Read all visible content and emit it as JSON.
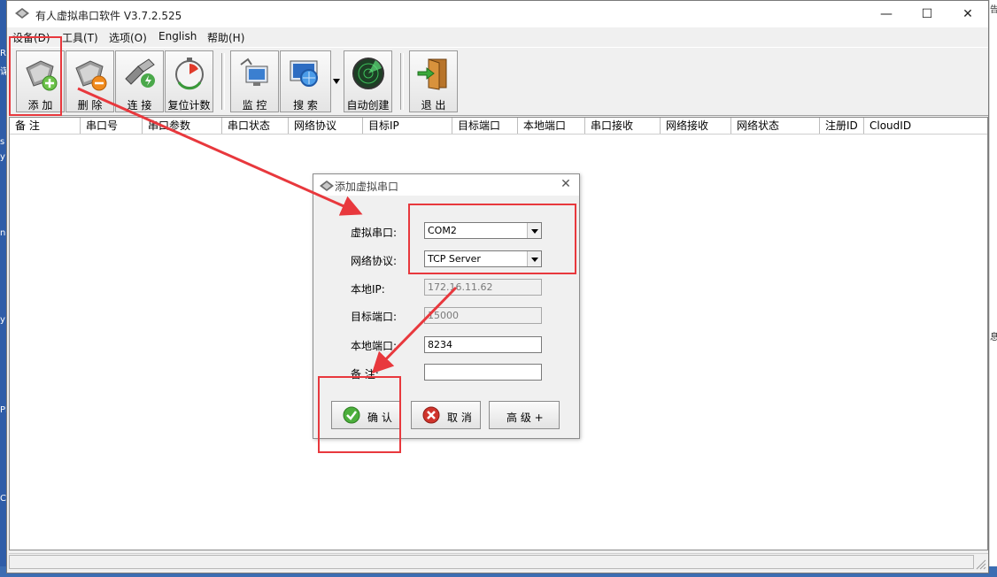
{
  "app": {
    "title": "有人虚拟串口软件 V3.7.2.525",
    "window_controls": {
      "minimize": "—",
      "maximize": "☐",
      "close": "✕"
    }
  },
  "menu": [
    "设备(D)",
    "工具(T)",
    "选项(O)",
    "English",
    "帮助(H)"
  ],
  "toolbar": {
    "add": "添 加",
    "delete": "删 除",
    "connect": "连 接",
    "reset_count": "复位计数",
    "monitor": "监 控",
    "search": "搜 索",
    "auto_create": "自动创建",
    "exit": "退 出"
  },
  "list": {
    "columns": [
      "备 注",
      "串口号",
      "串口参数",
      "串口状态",
      "网络协议",
      "目标IP",
      "目标端口",
      "本地端口",
      "串口接收",
      "网络接收",
      "网络状态",
      "注册ID",
      "CloudID"
    ]
  },
  "dialog": {
    "title": "添加虚拟串口",
    "close": "✕",
    "fields": {
      "virtual_port_label": "虚拟串口:",
      "virtual_port_value": "COM2",
      "protocol_label": "网络协议:",
      "protocol_value": "TCP Server",
      "local_ip_label": "本地IP:",
      "local_ip_value": "172.16.11.62",
      "target_port_label": "目标端口:",
      "target_port_value": "15000",
      "local_port_label": "本地端口:",
      "local_port_value": "8234",
      "note_label": "备 注:",
      "note_value": ""
    },
    "buttons": {
      "confirm": "确 认",
      "cancel": "取 消",
      "advanced": "高 级 +"
    }
  },
  "desktop": {
    "left_fragments": [
      "R",
      "谋",
      "s",
      "y",
      "n",
      "y",
      "Pl",
      "C"
    ],
    "right_fragments": [
      "告",
      "息"
    ]
  },
  "colors": {
    "annotation_red": "#e8383d",
    "window_bg": "#f0f0f0",
    "desktop_blue": "#2f5da8"
  }
}
